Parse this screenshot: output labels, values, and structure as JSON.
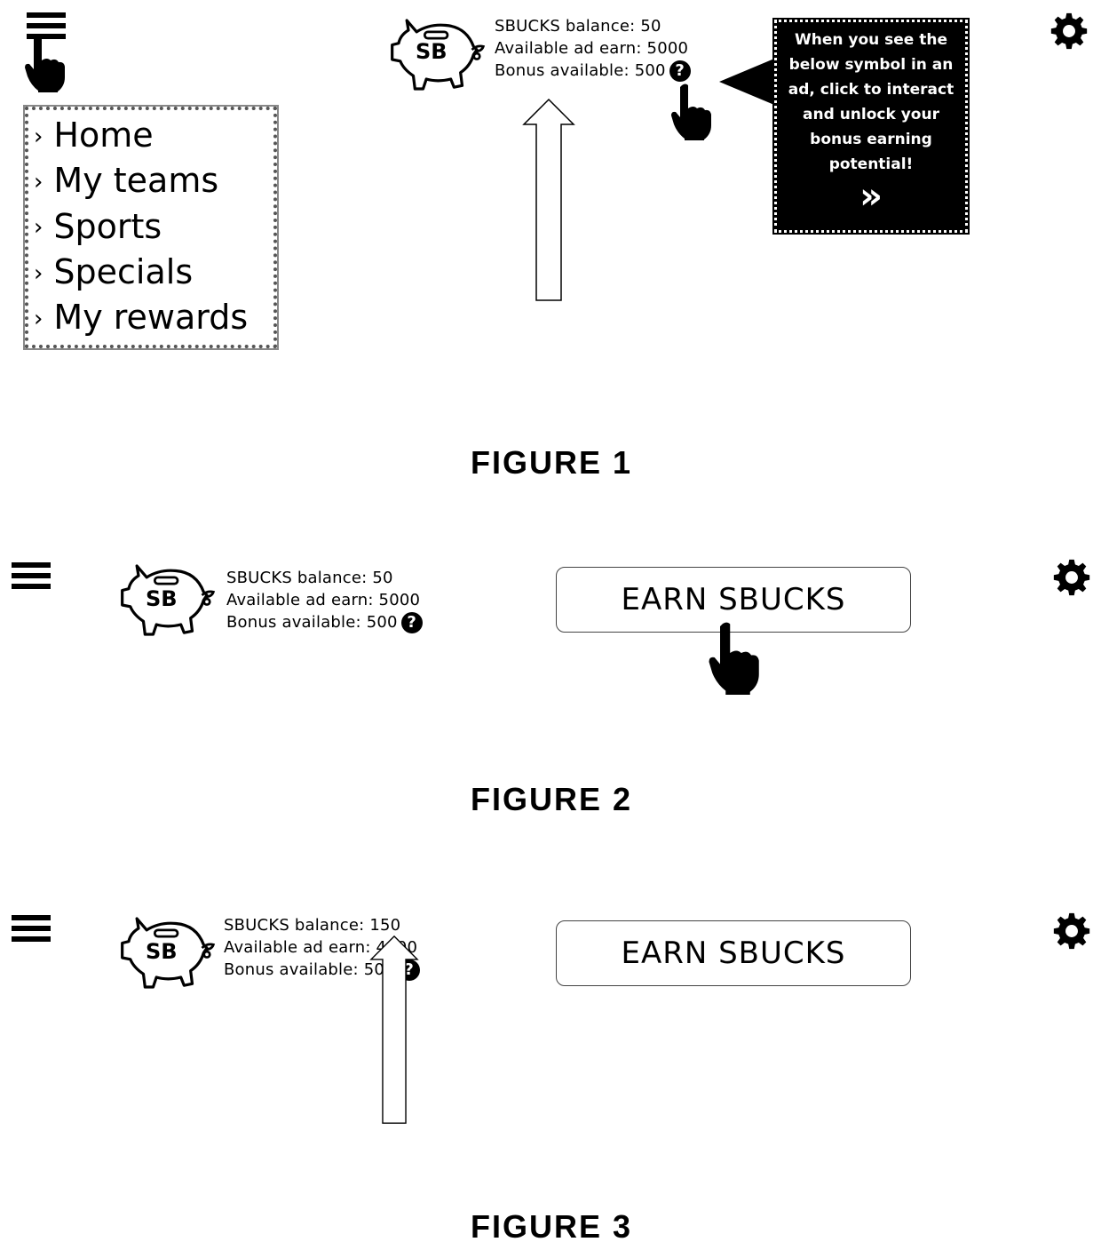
{
  "figures": [
    {
      "label": "FIGURE 1",
      "stats": {
        "balance": "SBUCKS balance: 50",
        "ad_earn": "Available ad earn: 5000",
        "bonus": "Bonus available: 500"
      },
      "logo_text": "SB",
      "menu": {
        "items": [
          {
            "chevron": "›",
            "label": "Home"
          },
          {
            "chevron": "›",
            "label": "My teams"
          },
          {
            "chevron": "›",
            "label": "Sports"
          },
          {
            "chevron": "›",
            "label": "Specials"
          },
          {
            "chevron": "›",
            "label": "My rewards"
          }
        ]
      },
      "tooltip": {
        "lines": [
          "When you see the",
          "below symbol in an",
          "ad, click to interact",
          "and unlock your",
          "bonus earning",
          "potential!"
        ],
        "symbol": "»"
      },
      "help_glyph": "?"
    },
    {
      "label": "FIGURE 2",
      "stats": {
        "balance": "SBUCKS balance: 50",
        "ad_earn": "Available ad earn: 5000",
        "bonus": "Bonus available: 500"
      },
      "logo_text": "SB",
      "earn_button": "EARN SBUCKS",
      "help_glyph": "?"
    },
    {
      "label": "FIGURE 3",
      "stats": {
        "balance": "SBUCKS balance: 150",
        "ad_earn": "Available ad earn: 4900",
        "bonus": "Bonus available: 500"
      },
      "logo_text": "SB",
      "earn_button": "EARN SBUCKS",
      "help_glyph": "?"
    }
  ],
  "icons": {
    "menu": "hamburger-icon",
    "settings": "gear-icon",
    "logo": "piggy-bank-icon",
    "help": "question-icon",
    "pointer": "pointing-hand-icon",
    "arrow": "up-arrow-icon"
  }
}
